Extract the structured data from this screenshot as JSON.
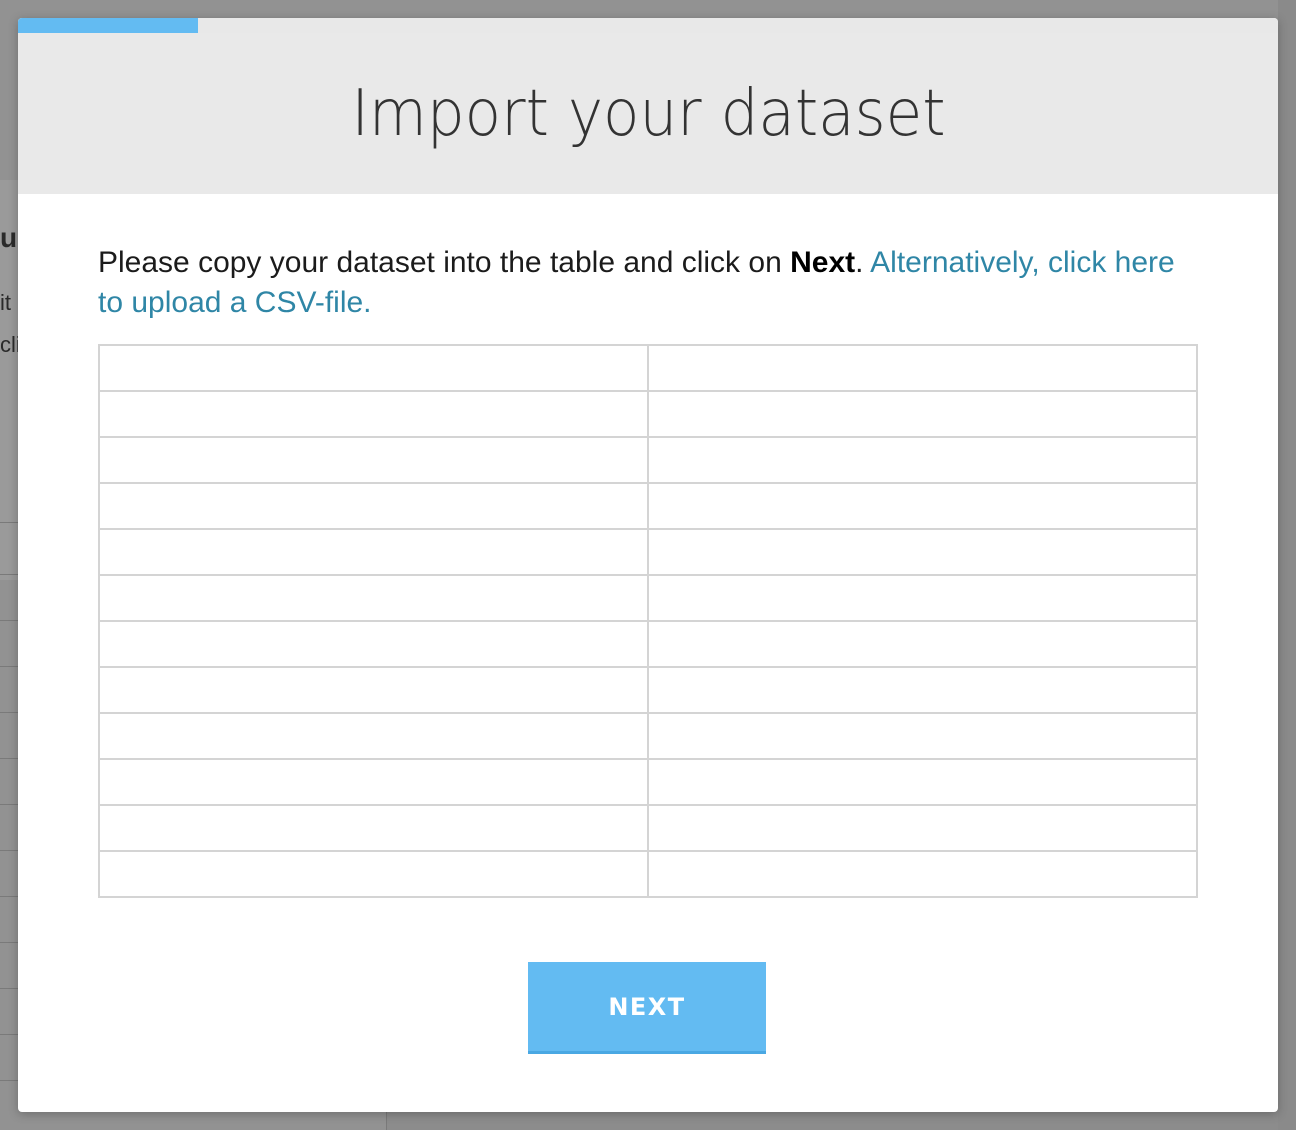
{
  "modal": {
    "title": "Import your dataset",
    "progress_fraction": 0.143,
    "instructions": {
      "text_before": "Please copy your dataset into the table and click on ",
      "bold": "Next",
      "text_after": ". ",
      "link": "Alternatively, click here to upload a CSV-file."
    },
    "table": {
      "columns": 2,
      "rows": [
        [
          "",
          ""
        ],
        [
          "",
          ""
        ],
        [
          "",
          ""
        ],
        [
          "",
          ""
        ],
        [
          "",
          ""
        ],
        [
          "",
          ""
        ],
        [
          "",
          ""
        ],
        [
          "",
          ""
        ],
        [
          "",
          ""
        ],
        [
          "",
          ""
        ],
        [
          "",
          ""
        ],
        [
          "",
          ""
        ]
      ]
    },
    "next_button": "NEXT"
  },
  "background": {
    "fragments": [
      "ur",
      "it",
      "cli"
    ]
  },
  "colors": {
    "accent": "#63bbf2",
    "link": "#2f86a6",
    "header_bg": "#e9e9e9",
    "overlay": "#929292"
  }
}
